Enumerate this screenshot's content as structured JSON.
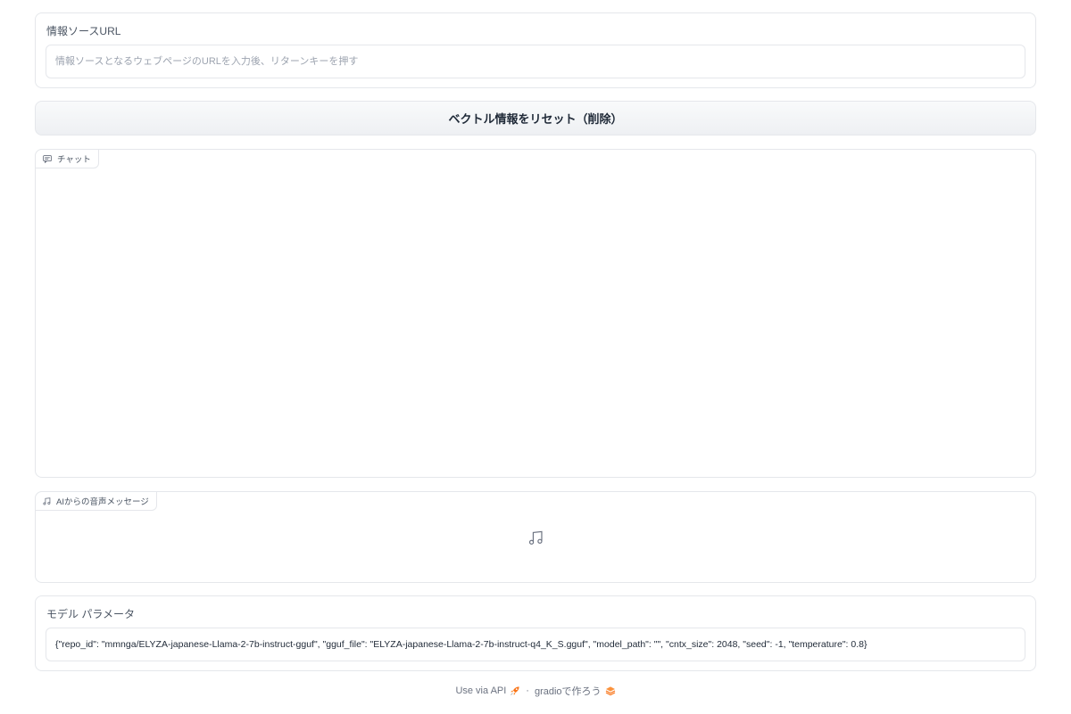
{
  "source": {
    "label": "情報ソースURL",
    "placeholder": "情報ソースとなるウェブページのURLを入力後、リターンキーを押す",
    "value": ""
  },
  "reset_button_label": "ベクトル情報をリセット（削除）",
  "chat": {
    "label": "チャット",
    "icon": "chat-icon"
  },
  "audio": {
    "label": "AIからの音声メッセージ",
    "icon": "music-note-icon"
  },
  "params": {
    "label": "モデル パラメータ",
    "value": "{\"repo_id\": \"mmnga/ELYZA-japanese-Llama-2-7b-instruct-gguf\", \"gguf_file\": \"ELYZA-japanese-Llama-2-7b-instruct-q4_K_S.gguf\", \"model_path\": \"\", \"cntx_size\": 2048, \"seed\": -1, \"temperature\": 0.8}"
  },
  "footer": {
    "api_link": "Use via API",
    "separator": "·",
    "gradio_link": "gradioで作ろう",
    "rocket_icon": "rocket-icon",
    "gradio_logo": "gradio-logo-icon",
    "accent_color": "#f97316"
  }
}
